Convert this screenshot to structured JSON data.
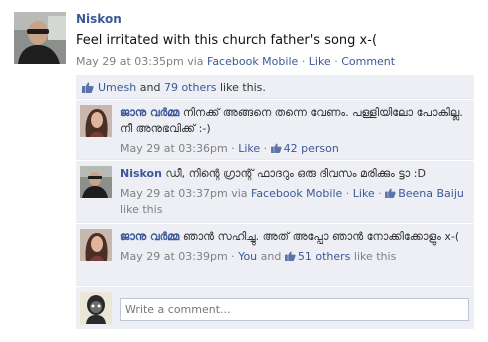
{
  "post": {
    "author": "Niskon",
    "text": "Feel irritated with this church father's song x-(",
    "time": "May 29 at 03:35pm",
    "via": "via",
    "source": "Facebook Mobile",
    "like_label": "Like",
    "comment_label": "Comment",
    "separator": " · "
  },
  "likes": {
    "user": "Umesh",
    "and": "and",
    "others": "79 others",
    "suffix": "like this."
  },
  "comments": [
    {
      "author": "ജാനു വർമ്മ",
      "text": "നിനക്ക് അങ്ങനെ തന്നെ വേണം. പള്ളിയിലോ പോകില്ല. നീ അനുഭവിക്ക് :-)",
      "time": "May 29 at 03:36pm",
      "like_label": "Like",
      "like_count": "42 person"
    },
    {
      "author": "Niskon",
      "text": "ഡീ, നിന്റെ ഗ്രാന്റ് ഫാദറും ഒരു ദിവസം മരിക്കും ട്ടാ :D",
      "time": "May 29 at 03:37pm",
      "via": "via",
      "source": "Facebook Mobile",
      "like_label": "Like",
      "like_user": "Beena Baiju",
      "like_suffix": "like this"
    },
    {
      "author": "ജാനു വർമ്മ",
      "text": "ഞാൻ സഹിച്ചു. അത് അപ്പോ ഞാൻ നോക്കിക്കോളും x-(",
      "time": "May 29 at 03:39pm",
      "you": "You",
      "and": "and",
      "others": "51 others",
      "suffix": "like this"
    }
  ],
  "reply": {
    "placeholder": "Write a comment..."
  },
  "colors": {
    "link": "#3b5998",
    "feedback_bg": "#edeff4",
    "meta": "#808080"
  }
}
